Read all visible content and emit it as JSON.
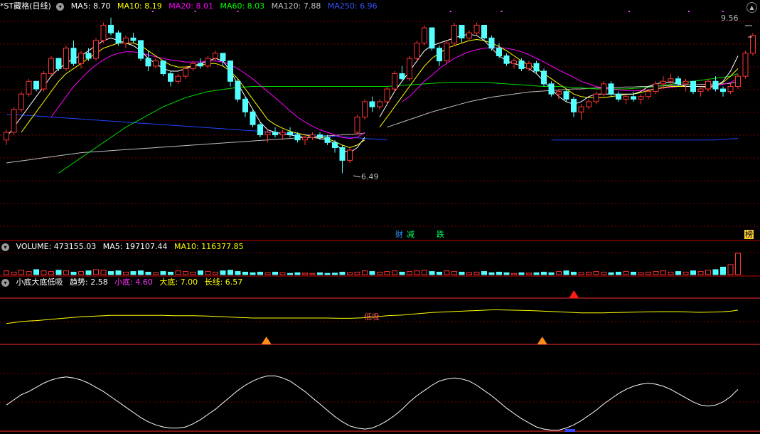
{
  "main": {
    "title": "*ST藏格(日线)",
    "ma": [
      {
        "label": "MA5: 8.70",
        "color": "#ffffff"
      },
      {
        "label": "MA10: 8.19",
        "color": "#ffff00"
      },
      {
        "label": "MA20: 8.01",
        "color": "#ff00ff"
      },
      {
        "label": "MA60: 8.03",
        "color": "#00ff00"
      },
      {
        "label": "MA120: 7.88",
        "color": "#c0c0c0"
      },
      {
        "label": "MA250: 6.96",
        "color": "#3355ff"
      }
    ],
    "high_label": "9.56",
    "low_label": "6.49",
    "events": [
      {
        "text": "财",
        "color": "#3399ff"
      },
      {
        "text": "减",
        "color": "#00ff66"
      },
      {
        "text": "跌",
        "color": "#00ff66"
      },
      {
        "text": "榜",
        "color": "#ffcc33"
      }
    ]
  },
  "volume": {
    "label": "VOLUME: 473155.03",
    "ma5": "MA5: 197107.44",
    "ma10": "MA10: 116377.85"
  },
  "indicator": {
    "name": "小底大底低吸",
    "trend": "趋势: 2.58",
    "small": "小底: 4.60",
    "big": "大底: 7.00",
    "long": "长线: 6.57",
    "annotation": "低吸"
  },
  "colors": {
    "up": "#ff3333",
    "down": "#54ffff",
    "grid": "#7a0000",
    "axis": "#c00000"
  },
  "chart_data": {
    "type": "candlestick",
    "price_high": 9.56,
    "price_low": 6.49,
    "candles": [
      [
        7.15,
        7.35,
        7.05,
        7.3
      ],
      [
        7.3,
        7.8,
        7.25,
        7.75
      ],
      [
        7.75,
        8.1,
        7.7,
        8.05
      ],
      [
        8.05,
        8.35,
        8.0,
        8.3
      ],
      [
        8.3,
        8.25,
        8.1,
        8.15
      ],
      [
        8.15,
        8.5,
        8.1,
        8.45
      ],
      [
        8.45,
        8.8,
        8.4,
        8.75
      ],
      [
        8.75,
        8.7,
        8.5,
        8.55
      ],
      [
        8.55,
        9.0,
        8.5,
        8.95
      ],
      [
        8.95,
        9.1,
        8.6,
        8.65
      ],
      [
        8.65,
        8.9,
        8.55,
        8.85
      ],
      [
        8.85,
        8.95,
        8.7,
        8.75
      ],
      [
        8.75,
        9.15,
        8.7,
        9.1
      ],
      [
        9.1,
        9.45,
        9.05,
        9.4
      ],
      [
        9.4,
        9.55,
        9.2,
        9.25
      ],
      [
        9.25,
        9.3,
        9.0,
        9.05
      ],
      [
        9.05,
        9.2,
        8.95,
        9.15
      ],
      [
        9.15,
        9.25,
        9.05,
        9.1
      ],
      [
        9.1,
        9.0,
        8.7,
        8.75
      ],
      [
        8.75,
        8.9,
        8.5,
        8.6
      ],
      [
        8.6,
        8.75,
        8.55,
        8.7
      ],
      [
        8.7,
        8.65,
        8.4,
        8.45
      ],
      [
        8.45,
        8.5,
        8.2,
        8.3
      ],
      [
        8.3,
        8.45,
        8.25,
        8.4
      ],
      [
        8.4,
        8.6,
        8.35,
        8.55
      ],
      [
        8.55,
        8.7,
        8.5,
        8.65
      ],
      [
        8.65,
        8.75,
        8.55,
        8.6
      ],
      [
        8.6,
        8.8,
        8.55,
        8.75
      ],
      [
        8.75,
        8.9,
        8.7,
        8.85
      ],
      [
        8.85,
        8.8,
        8.6,
        8.7
      ],
      [
        8.7,
        8.6,
        8.2,
        8.3
      ],
      [
        8.3,
        8.35,
        7.9,
        7.95
      ],
      [
        7.95,
        8.0,
        7.6,
        7.7
      ],
      [
        7.7,
        7.75,
        7.4,
        7.45
      ],
      [
        7.45,
        7.5,
        7.2,
        7.25
      ],
      [
        7.25,
        7.35,
        7.1,
        7.3
      ],
      [
        7.3,
        7.4,
        7.2,
        7.25
      ],
      [
        7.25,
        7.35,
        7.15,
        7.3
      ],
      [
        7.3,
        7.4,
        7.2,
        7.25
      ],
      [
        7.25,
        7.3,
        7.1,
        7.15
      ],
      [
        7.15,
        7.25,
        7.05,
        7.2
      ],
      [
        7.2,
        7.3,
        7.15,
        7.25
      ],
      [
        7.25,
        7.3,
        7.15,
        7.2
      ],
      [
        7.2,
        7.25,
        7.05,
        7.1
      ],
      [
        7.1,
        7.15,
        6.9,
        7.0
      ],
      [
        7.0,
        7.05,
        6.5,
        6.75
      ],
      [
        6.75,
        7.0,
        6.7,
        6.95
      ],
      [
        7.3,
        7.65,
        7.25,
        7.6
      ],
      [
        7.6,
        7.95,
        7.55,
        7.9
      ],
      [
        7.9,
        8.0,
        7.7,
        7.8
      ],
      [
        7.8,
        7.95,
        7.75,
        7.9
      ],
      [
        7.9,
        8.2,
        7.85,
        8.15
      ],
      [
        8.15,
        8.5,
        8.1,
        8.45
      ],
      [
        8.45,
        8.6,
        8.3,
        8.35
      ],
      [
        8.35,
        8.8,
        8.3,
        8.75
      ],
      [
        8.75,
        9.1,
        8.7,
        9.05
      ],
      [
        9.05,
        9.4,
        9.0,
        9.35
      ],
      [
        9.35,
        9.3,
        8.9,
        8.95
      ],
      [
        8.95,
        9.0,
        8.6,
        8.7
      ],
      [
        8.7,
        9.1,
        8.65,
        9.05
      ],
      [
        9.05,
        9.45,
        9.0,
        9.4
      ],
      [
        9.4,
        9.35,
        9.05,
        9.15
      ],
      [
        9.15,
        9.3,
        9.1,
        9.25
      ],
      [
        9.25,
        9.45,
        9.2,
        9.4
      ],
      [
        9.4,
        9.4,
        9.1,
        9.15
      ],
      [
        9.15,
        9.2,
        8.9,
        8.95
      ],
      [
        8.95,
        9.05,
        8.75,
        8.8
      ],
      [
        8.8,
        8.85,
        8.6,
        8.65
      ],
      [
        8.65,
        8.75,
        8.55,
        8.7
      ],
      [
        8.7,
        8.75,
        8.5,
        8.55
      ],
      [
        8.55,
        8.7,
        8.5,
        8.65
      ],
      [
        8.65,
        8.7,
        8.45,
        8.5
      ],
      [
        8.5,
        8.55,
        8.2,
        8.25
      ],
      [
        8.25,
        8.3,
        8.0,
        8.05
      ],
      [
        8.05,
        8.15,
        7.95,
        8.1
      ],
      [
        8.1,
        8.15,
        7.9,
        7.95
      ],
      [
        7.95,
        8.0,
        7.6,
        7.7
      ],
      [
        7.7,
        7.85,
        7.55,
        7.8
      ],
      [
        7.8,
        7.95,
        7.75,
        7.9
      ],
      [
        7.9,
        8.1,
        7.85,
        8.05
      ],
      [
        8.05,
        8.3,
        8.0,
        8.25
      ],
      [
        8.25,
        8.3,
        8.0,
        8.05
      ],
      [
        8.05,
        8.1,
        7.9,
        7.95
      ],
      [
        7.95,
        8.05,
        7.85,
        8.0
      ],
      [
        8.0,
        8.1,
        7.9,
        7.95
      ],
      [
        7.95,
        8.05,
        7.85,
        8.0
      ],
      [
        8.0,
        8.15,
        7.95,
        8.1
      ],
      [
        8.1,
        8.3,
        8.05,
        8.25
      ],
      [
        8.25,
        8.4,
        8.15,
        8.3
      ],
      [
        8.3,
        8.45,
        8.2,
        8.35
      ],
      [
        8.35,
        8.4,
        8.2,
        8.25
      ],
      [
        8.25,
        8.35,
        8.1,
        8.3
      ],
      [
        8.3,
        8.3,
        8.05,
        8.1
      ],
      [
        8.1,
        8.2,
        8.0,
        8.15
      ],
      [
        8.15,
        8.35,
        8.1,
        8.3
      ],
      [
        8.3,
        8.4,
        8.1,
        8.15
      ],
      [
        8.15,
        8.2,
        8.0,
        8.1
      ],
      [
        8.1,
        8.25,
        8.05,
        8.2
      ],
      [
        8.2,
        8.45,
        8.15,
        8.4
      ],
      [
        8.4,
        8.9,
        8.35,
        8.85
      ],
      [
        8.85,
        9.25,
        8.8,
        9.2
      ]
    ],
    "ma5": [
      7.2,
      7.4,
      7.6,
      7.8,
      8.0,
      8.2,
      8.4,
      8.55,
      8.65,
      8.75,
      8.8,
      8.9,
      9.0,
      9.1,
      9.15,
      9.1,
      9.05,
      9.0,
      8.9,
      8.75,
      8.65,
      8.55,
      8.5,
      8.5,
      8.55,
      8.6,
      8.65,
      8.7,
      8.75,
      8.7,
      8.5,
      8.25,
      8.0,
      7.75,
      7.5,
      7.35,
      7.3,
      7.27,
      7.25,
      7.22,
      7.2,
      7.2,
      7.18,
      7.15,
      7.08,
      6.95,
      6.9,
      7.0,
      7.2,
      null,
      7.6,
      7.85,
      8.1,
      8.3,
      8.5,
      8.7,
      8.9,
      9.0,
      9.05,
      9.1,
      9.15,
      9.2,
      9.22,
      9.2,
      9.1,
      8.95,
      8.8,
      8.7,
      8.65,
      8.6,
      8.55,
      8.45,
      8.3,
      8.15,
      8.0,
      7.9,
      7.85,
      7.9,
      8.0,
      8.05,
      8.05,
      8.05,
      8.05,
      8.05,
      8.05,
      8.1,
      8.2,
      8.25,
      8.28,
      8.28,
      8.25,
      8.2,
      8.2,
      8.2,
      8.18,
      8.2,
      8.3,
      8.5,
      8.8
    ],
    "ma10": [
      null,
      null,
      7.3,
      7.5,
      7.7,
      7.9,
      8.1,
      8.3,
      8.45,
      8.55,
      8.65,
      8.75,
      8.85,
      8.95,
      9.0,
      9.05,
      9.05,
      9.05,
      9.0,
      8.9,
      8.8,
      8.7,
      8.62,
      8.58,
      8.58,
      8.6,
      8.62,
      8.65,
      8.65,
      8.6,
      8.5,
      8.35,
      8.15,
      7.95,
      7.75,
      7.55,
      7.45,
      7.38,
      7.32,
      7.28,
      7.25,
      7.22,
      7.2,
      7.18,
      7.12,
      7.05,
      7.0,
      7.05,
      7.15,
      null,
      7.4,
      7.6,
      7.8,
      8.0,
      8.2,
      8.4,
      8.6,
      8.75,
      8.85,
      8.95,
      9.0,
      9.05,
      9.1,
      9.12,
      9.1,
      9.05,
      8.98,
      8.9,
      8.8,
      8.7,
      8.62,
      8.55,
      8.45,
      8.35,
      8.25,
      8.15,
      8.05,
      8.0,
      7.98,
      7.98,
      7.98,
      8.0,
      8.02,
      8.04,
      8.05,
      8.08,
      8.12,
      8.15,
      8.18,
      8.2,
      8.2,
      8.2,
      8.2,
      8.2,
      8.2,
      8.22,
      8.28,
      8.4,
      8.55
    ],
    "ma20": [
      null,
      null,
      null,
      null,
      null,
      null,
      7.6,
      7.8,
      8.0,
      8.2,
      8.35,
      8.5,
      8.62,
      8.72,
      8.8,
      8.85,
      8.88,
      8.88,
      8.85,
      8.82,
      8.78,
      8.75,
      8.72,
      8.7,
      8.68,
      8.68,
      8.68,
      8.7,
      8.7,
      8.68,
      8.62,
      8.55,
      8.45,
      8.35,
      8.22,
      8.1,
      7.98,
      7.85,
      7.72,
      7.6,
      7.5,
      7.42,
      7.35,
      7.3,
      7.25,
      7.2,
      7.18,
      7.2,
      7.3,
      null,
      null,
      null,
      null,
      7.9,
      8.0,
      8.15,
      8.3,
      8.42,
      8.55,
      8.65,
      8.75,
      8.82,
      8.88,
      8.92,
      8.95,
      8.96,
      8.96,
      8.95,
      8.92,
      8.88,
      8.82,
      8.75,
      8.68,
      8.6,
      8.52,
      8.45,
      8.38,
      8.3,
      8.25,
      8.2,
      8.17,
      8.15,
      8.13,
      8.12,
      8.12,
      8.12,
      8.13,
      8.15,
      8.17,
      8.18,
      8.2,
      8.2,
      8.2,
      8.2,
      8.2,
      8.21,
      8.24,
      8.28,
      8.35
    ],
    "ma60": [
      null,
      null,
      null,
      null,
      null,
      null,
      null,
      6.5,
      6.6,
      6.7,
      6.8,
      6.9,
      7.0,
      7.1,
      7.2,
      7.3,
      7.4,
      7.48,
      7.56,
      7.64,
      7.72,
      7.8,
      7.86,
      7.92,
      7.98,
      8.02,
      8.06,
      8.1,
      8.12,
      8.14,
      8.16,
      8.18,
      8.19,
      8.2,
      8.2,
      8.2,
      8.2,
      8.2,
      8.2,
      8.2,
      8.2,
      8.2,
      8.2,
      8.2,
      8.2,
      8.2,
      8.2,
      8.2,
      8.2,
      8.2,
      8.2,
      8.2,
      8.21,
      8.22,
      8.23,
      8.24,
      8.25,
      8.26,
      8.27,
      8.28,
      8.28,
      8.28,
      8.28,
      8.28,
      8.28,
      8.27,
      8.26,
      8.25,
      8.24,
      8.23,
      8.22,
      8.21,
      8.2,
      8.2,
      8.2,
      8.19,
      8.18,
      8.17,
      8.16,
      8.15,
      8.15,
      8.15,
      8.15,
      8.15,
      8.16,
      8.17,
      8.18,
      8.2,
      8.22,
      8.24,
      8.26,
      8.28,
      8.3,
      8.32,
      8.34,
      8.36,
      8.38,
      8.4,
      8.45
    ],
    "ma120": [
      6.7,
      6.72,
      6.74,
      6.76,
      6.78,
      6.8,
      6.82,
      6.84,
      6.86,
      6.88,
      6.9,
      6.91,
      6.92,
      6.93,
      6.94,
      6.95,
      6.96,
      6.97,
      6.98,
      6.99,
      7.0,
      7.01,
      7.02,
      7.03,
      7.04,
      7.05,
      7.06,
      7.07,
      7.08,
      7.09,
      7.1,
      7.11,
      7.12,
      7.13,
      7.14,
      7.15,
      7.16,
      7.17,
      7.18,
      7.19,
      7.2,
      7.21,
      7.22,
      7.23,
      7.24,
      7.25,
      7.26,
      7.27,
      7.28,
      null,
      null,
      7.4,
      7.45,
      7.5,
      7.55,
      7.6,
      7.65,
      7.7,
      7.74,
      7.78,
      7.82,
      7.86,
      7.9,
      7.93,
      7.96,
      7.99,
      8.01,
      8.03,
      8.05,
      8.07,
      8.09,
      8.1,
      8.11,
      8.12,
      8.13,
      8.14,
      8.15,
      8.15,
      8.16,
      8.17,
      8.17,
      8.18,
      8.18,
      8.19,
      8.19,
      8.2,
      8.2,
      8.21,
      8.21,
      8.22,
      8.22,
      8.23,
      8.23,
      8.24,
      8.24,
      8.25,
      8.25,
      8.26,
      8.3
    ],
    "ma250": [
      7.65,
      7.65,
      7.64,
      7.63,
      7.62,
      7.61,
      7.6,
      7.59,
      7.58,
      7.57,
      7.56,
      7.55,
      7.54,
      7.53,
      7.52,
      7.51,
      7.5,
      7.49,
      7.48,
      7.47,
      7.46,
      7.45,
      7.44,
      7.43,
      7.42,
      7.41,
      7.4,
      7.39,
      7.38,
      7.37,
      7.36,
      7.35,
      7.34,
      7.33,
      7.32,
      7.31,
      7.3,
      7.29,
      7.28,
      7.27,
      7.26,
      7.25,
      7.24,
      7.23,
      7.22,
      7.21,
      7.2,
      7.19,
      7.18,
      7.17,
      7.16,
      7.15,
      null,
      null,
      null,
      null,
      null,
      null,
      null,
      null,
      null,
      null,
      null,
      null,
      null,
      null,
      null,
      null,
      null,
      null,
      null,
      null,
      null,
      7.15,
      7.15,
      7.15,
      7.15,
      7.15,
      7.15,
      7.15,
      7.15,
      7.15,
      7.15,
      7.15,
      7.15,
      7.15,
      7.15,
      7.15,
      7.15,
      7.15,
      7.15,
      7.15,
      7.15,
      7.15,
      7.15,
      7.15,
      7.16,
      7.17,
      7.18
    ],
    "volume": [
      30,
      20,
      35,
      25,
      40,
      30,
      25,
      35,
      30,
      20,
      25,
      30,
      40,
      35,
      25,
      30,
      20,
      25,
      30,
      20,
      15,
      25,
      20,
      30,
      25,
      20,
      30,
      25,
      20,
      30,
      35,
      25,
      20,
      15,
      20,
      15,
      20,
      15,
      10,
      15,
      12,
      10,
      15,
      10,
      12,
      20,
      15,
      20,
      30,
      25,
      20,
      25,
      30,
      20,
      25,
      30,
      35,
      25,
      20,
      30,
      25,
      20,
      15,
      20,
      25,
      15,
      20,
      15,
      10,
      15,
      12,
      15,
      20,
      15,
      25,
      30,
      20,
      15,
      20,
      25,
      20,
      15,
      20,
      25,
      20,
      15,
      20,
      25,
      30,
      20,
      25,
      20,
      30,
      25,
      35,
      40,
      60,
      80,
      170
    ],
    "trend": [
      3.2,
      3.35,
      3.5,
      3.6,
      3.65,
      3.75,
      3.85,
      3.95,
      4.05,
      4.15,
      4.25,
      4.3,
      4.35,
      4.4,
      4.45,
      4.45,
      4.45,
      4.45,
      4.45,
      4.45,
      4.45,
      4.45,
      4.42,
      4.4,
      4.4,
      4.4,
      4.38,
      4.35,
      4.3,
      4.25,
      4.2,
      4.15,
      4.1,
      4.05,
      4.05,
      4.05,
      4.05,
      4.05,
      4.05,
      4.05,
      4.05,
      4.05,
      4.05,
      4.05,
      4.02,
      4.0,
      4.0,
      4.05,
      4.1,
      4.2,
      4.3,
      4.4,
      4.45,
      4.5,
      4.6,
      4.7,
      4.8,
      4.9,
      4.95,
      5.0,
      5.05,
      5.1,
      5.15,
      5.2,
      5.25,
      5.3,
      5.3,
      5.28,
      5.25,
      5.22,
      5.2,
      5.15,
      5.1,
      5.05,
      5.0,
      4.95,
      4.9,
      4.85,
      4.85,
      4.85,
      4.85,
      4.88,
      4.9,
      4.92,
      4.95,
      4.98,
      5.0,
      5.02,
      5.03,
      5.03,
      5.03,
      5.0,
      4.95,
      4.92,
      4.95,
      4.98,
      5.02,
      5.1,
      5.25
    ],
    "long": [
      2.5,
      3.0,
      3.5,
      3.8,
      4.2,
      4.6,
      4.9,
      5.1,
      5.2,
      5.1,
      4.9,
      4.6,
      4.2,
      3.8,
      3.3,
      2.8,
      2.3,
      1.8,
      1.3,
      0.9,
      0.6,
      0.4,
      0.3,
      0.3,
      0.4,
      0.7,
      1.1,
      1.6,
      2.1,
      2.7,
      3.3,
      3.9,
      4.4,
      4.8,
      5.1,
      5.3,
      5.3,
      5.1,
      4.8,
      4.3,
      3.8,
      3.2,
      2.6,
      2.0,
      1.4,
      0.9,
      0.5,
      0.3,
      0.2,
      0.3,
      0.6,
      1.0,
      1.5,
      2.1,
      2.8,
      3.4,
      3.9,
      4.4,
      4.8,
      5.0,
      5.1,
      5.0,
      4.8,
      4.4,
      3.9,
      3.4,
      2.8,
      2.2,
      1.7,
      1.2,
      0.8,
      0.4,
      0.2,
      0.1,
      0.1,
      0.3,
      0.6,
      1.0,
      1.5,
      2.0,
      2.6,
      3.1,
      3.6,
      4.0,
      4.3,
      4.5,
      4.6,
      4.5,
      4.3,
      4.0,
      3.6,
      3.2,
      2.8,
      2.5,
      2.4,
      2.5,
      2.8,
      3.3,
      4.0
    ],
    "trend_range": [
      0,
      7
    ],
    "long_range": [
      0,
      6
    ],
    "gaps": [
      49
    ],
    "dot_rows": [
      17,
      22,
      27,
      52,
      58,
      73,
      80,
      84,
      90
    ],
    "up_markers": [
      78
    ],
    "down_markers": [
      31,
      64
    ]
  }
}
